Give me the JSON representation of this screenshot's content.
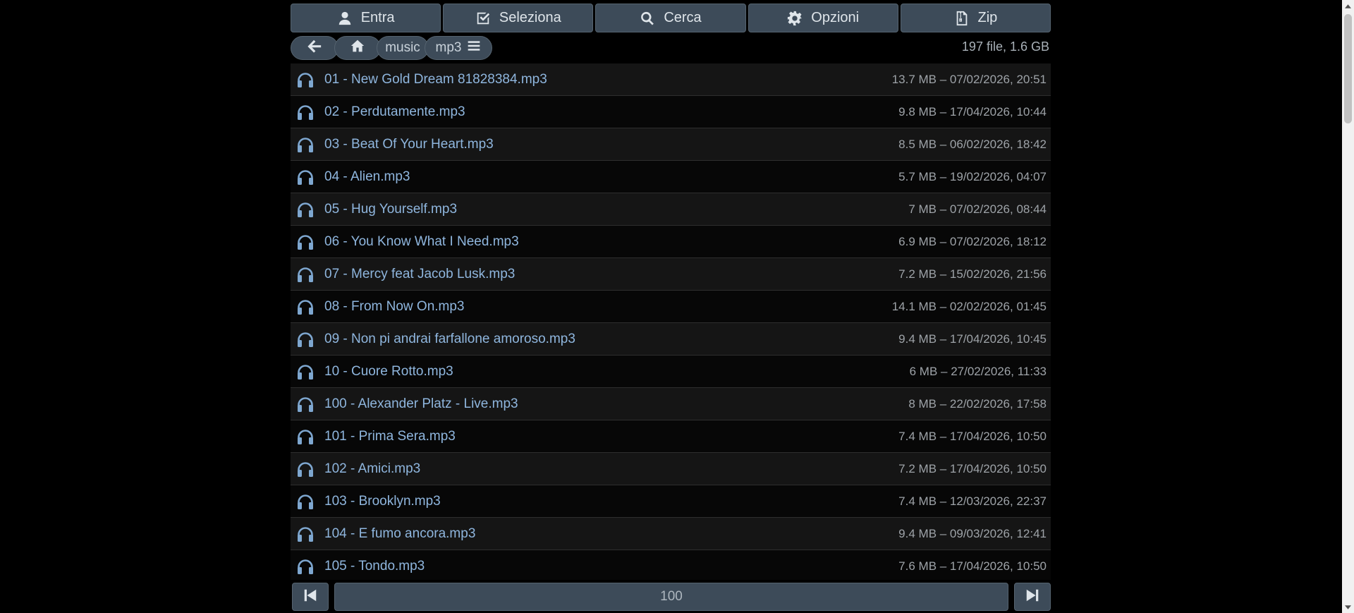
{
  "toolbar": {
    "buttons": [
      {
        "label": "Entra",
        "icon": "user-icon"
      },
      {
        "label": "Seleziona",
        "icon": "checkbox-icon"
      },
      {
        "label": "Cerca",
        "icon": "search-icon"
      },
      {
        "label": "Opzioni",
        "icon": "gear-icon"
      },
      {
        "label": "Zip",
        "icon": "zip-file-icon"
      }
    ]
  },
  "breadcrumb": {
    "back_icon": "arrow-left-icon",
    "home_icon": "home-icon",
    "items": [
      "music",
      "mp3"
    ],
    "menu_icon": "menu-icon"
  },
  "summary": "197 file, 1.6 GB",
  "files": [
    {
      "name": "01 - New Gold Dream 81828384.mp3",
      "meta": "13.7 MB – 07/02/2026, 20:51"
    },
    {
      "name": "02 - Perdutamente.mp3",
      "meta": "9.8 MB – 17/04/2026, 10:44"
    },
    {
      "name": "03 - Beat Of Your Heart.mp3",
      "meta": "8.5 MB – 06/02/2026, 18:42"
    },
    {
      "name": "04 - Alien.mp3",
      "meta": "5.7 MB – 19/02/2026, 04:07"
    },
    {
      "name": "05 - Hug Yourself.mp3",
      "meta": "7 MB – 07/02/2026, 08:44"
    },
    {
      "name": "06 - You Know What I Need.mp3",
      "meta": "6.9 MB – 07/02/2026, 18:12"
    },
    {
      "name": "07 - Mercy feat Jacob Lusk.mp3",
      "meta": "7.2 MB – 15/02/2026, 21:56"
    },
    {
      "name": "08 - From Now On.mp3",
      "meta": "14.1 MB – 02/02/2026, 01:45"
    },
    {
      "name": "09 - Non pi andrai farfallone amoroso.mp3",
      "meta": "9.4 MB – 17/04/2026, 10:45"
    },
    {
      "name": "10 - Cuore Rotto.mp3",
      "meta": "6 MB – 27/02/2026, 11:33"
    },
    {
      "name": "100 - Alexander Platz - Live.mp3",
      "meta": "8 MB – 22/02/2026, 17:58"
    },
    {
      "name": "101 - Prima Sera.mp3",
      "meta": "7.4 MB – 17/04/2026, 10:50"
    },
    {
      "name": "102 - Amici.mp3",
      "meta": "7.2 MB – 17/04/2026, 10:50"
    },
    {
      "name": "103 - Brooklyn.mp3",
      "meta": "7.4 MB – 12/03/2026, 22:37"
    },
    {
      "name": "104 - E fumo ancora.mp3",
      "meta": "9.4 MB – 09/03/2026, 12:41"
    },
    {
      "name": "105 - Tondo.mp3",
      "meta": "7.6 MB – 17/04/2026, 10:50"
    }
  ],
  "file_icon": "headphones-icon",
  "pager": {
    "page": "100",
    "prev_icon": "skip-back-icon",
    "next_icon": "skip-forward-icon"
  },
  "colors": {
    "background": "#000000",
    "button": "#3d4b59",
    "link": "#8fb6de",
    "icon": "#7ea7d0"
  }
}
